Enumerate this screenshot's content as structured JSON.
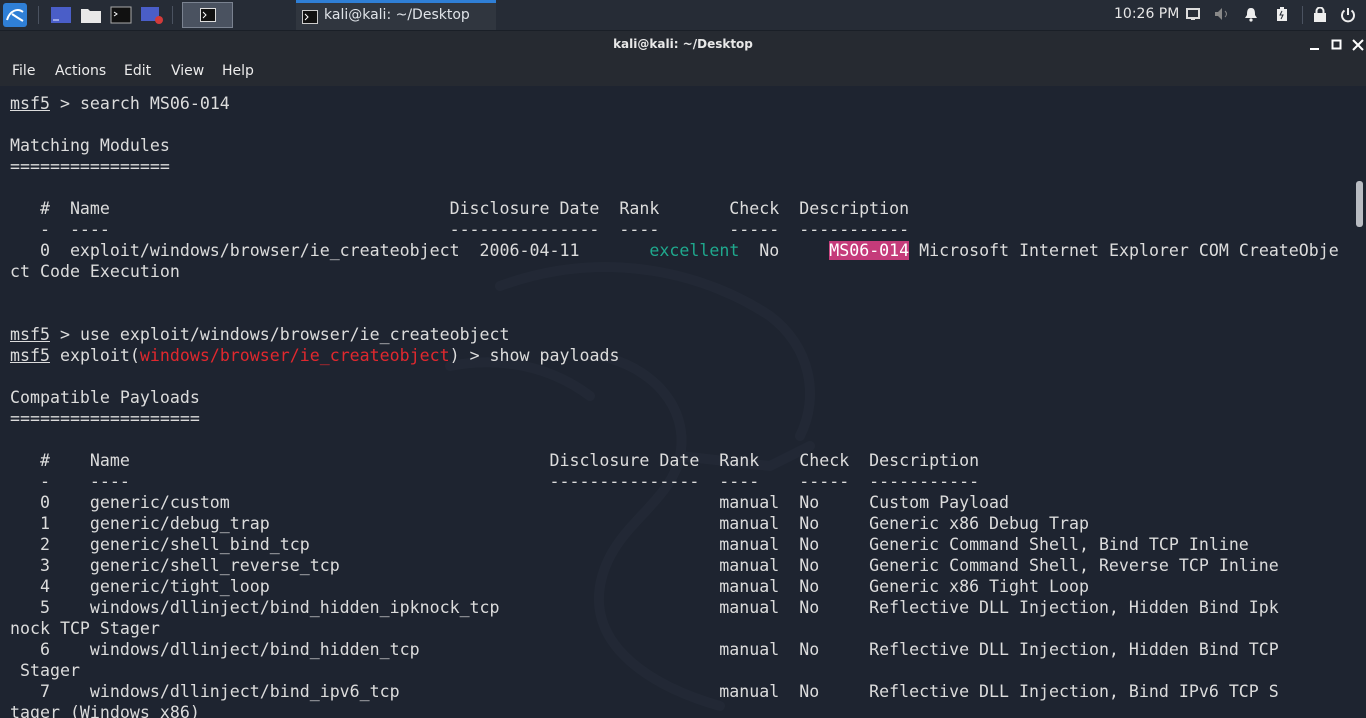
{
  "taskbar": {
    "window_tab_label": "kali@kali: ~/Desktop",
    "clock": "10:26 PM"
  },
  "window": {
    "title": "kali@kali: ~/Desktop"
  },
  "menu": [
    "File",
    "Actions",
    "Edit",
    "View",
    "Help"
  ],
  "terminal": {
    "prompt": "msf5",
    "cmd_search": " > search MS06-014",
    "matching_heading": "Matching Modules",
    "matching_rule": "================",
    "mod_header": "   #  Name                                  Disclosure Date  Rank       Check  Description",
    "mod_dashes": "   -  ----                                  ---------------  ----       -----  -----------",
    "mod_row_pre": "   0  exploit/windows/browser/ie_createobject  2006-04-11       ",
    "mod_rank": "excellent",
    "mod_row_mid": "  No     ",
    "mod_highlight": "MS06-014",
    "mod_row_post": " Microsoft Internet Explorer COM CreateObje",
    "mod_row_wrap": "ct Code Execution",
    "cmd_use": " > use exploit/windows/browser/ie_createobject",
    "exploit_word": " exploit(",
    "module_path": "windows/browser/ie_createobject",
    "cmd_show": ") > show payloads",
    "compat_heading": "Compatible Payloads",
    "compat_rule": "===================",
    "pay_header": "   #    Name                                          Disclosure Date  Rank    Check  Description",
    "pay_dashes": "   -    ----                                          ---------------  ----    -----  -----------",
    "payload_lines": [
      "   0    generic/custom                                                 manual  No     Custom Payload",
      "   1    generic/debug_trap                                             manual  No     Generic x86 Debug Trap",
      "   2    generic/shell_bind_tcp                                         manual  No     Generic Command Shell, Bind TCP Inline",
      "   3    generic/shell_reverse_tcp                                      manual  No     Generic Command Shell, Reverse TCP Inline",
      "   4    generic/tight_loop                                             manual  No     Generic x86 Tight Loop",
      "   5    windows/dllinject/bind_hidden_ipknock_tcp                      manual  No     Reflective DLL Injection, Hidden Bind Ipk",
      "nock TCP Stager",
      "   6    windows/dllinject/bind_hidden_tcp                              manual  No     Reflective DLL Injection, Hidden Bind TCP",
      " Stager",
      "   7    windows/dllinject/bind_ipv6_tcp                                manual  No     Reflective DLL Injection, Bind IPv6 TCP S",
      "tager (Windows x86)"
    ]
  },
  "colors": {
    "background": "#1e2430",
    "prompt_text": "#dcdcdc",
    "module_red": "#e0282e",
    "rank_green": "#1fa88d",
    "highlight": "#c53b7a",
    "accent_blue": "#2f7fd6"
  },
  "icons": [
    "kali-menu-icon",
    "workspace-icon",
    "file-manager-icon",
    "terminal-icon",
    "screen-recorder-icon",
    "screen-icon",
    "volume-icon",
    "bell-icon",
    "battery-icon",
    "lock-icon",
    "power-icon"
  ]
}
